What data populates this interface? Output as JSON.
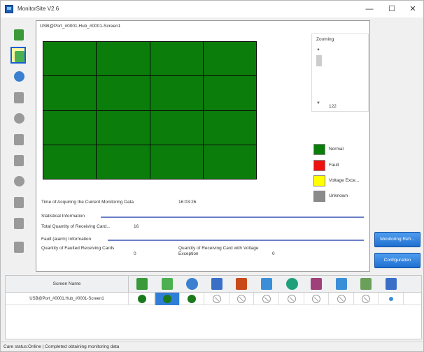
{
  "window": {
    "title": "MonitorSite V2.6",
    "minimize": "—",
    "maximize": "☐",
    "close": "✕"
  },
  "toolbar": {
    "items": [
      {
        "icon": "led-screen-icon",
        "color": "#3a9a3a"
      },
      {
        "icon": "receiving-card-icon",
        "color": "#4caf50",
        "selected": true
      },
      {
        "icon": "temperature-icon",
        "color": "#3a7fd0"
      },
      {
        "icon": "humidity-icon",
        "color": "#9a9a9a"
      },
      {
        "icon": "smoke-icon",
        "color": "#9a9a9a"
      },
      {
        "icon": "fan-icon",
        "color": "#9a9a9a"
      },
      {
        "icon": "module-icon",
        "color": "#9a9a9a"
      },
      {
        "icon": "voltage-icon",
        "color": "#9a9a9a"
      },
      {
        "icon": "magnet-icon",
        "color": "#9a9a9a"
      },
      {
        "icon": "door-icon",
        "color": "#9a9a9a"
      },
      {
        "icon": "cabinet-icon",
        "color": "#9a9a9a"
      }
    ]
  },
  "main": {
    "screen_title": "USB@Port_#0001.Hub_#0001-Screen1",
    "zoom": {
      "label": "Zooming",
      "value": "122",
      "up": "▲",
      "down": "▼"
    },
    "legend": [
      {
        "label": "Normal",
        "color": "#0b7d0b"
      },
      {
        "label": "Fault",
        "color": "#ee1111"
      },
      {
        "label": "Voltage Exce...",
        "color": "#ffff00"
      },
      {
        "label": "Unknown",
        "color": "#8a8a8a"
      }
    ],
    "acquire_label": "Time of Acquiring the Current Monitoring Data",
    "acquire_time": "16:03:26",
    "statistical_heading": "Statistical Information",
    "total_label": "Total Quantity of Receiving Card...",
    "total_value": "16",
    "fault_heading": "Fault (alarm) Information",
    "faulted_label": "Quantity of Faulted Receiving Cards",
    "faulted_value": "0",
    "voltage_label": "Quantity of Receiving Card with Voltage Exception",
    "voltage_value": "0"
  },
  "buttons": {
    "monitoring": "Monitoring Refr...",
    "configuration": "Configuration"
  },
  "table": {
    "header_name": "Screen Name",
    "row_name": "USB@Port_#0001.Hub_#0001-Screen1",
    "columns": [
      {
        "icon": "led-screen-icon",
        "color": "#3a9a3a",
        "status": "ok"
      },
      {
        "icon": "receiving-card-icon",
        "color": "#4caf50",
        "status": "ok",
        "selected": true
      },
      {
        "icon": "temperature-icon",
        "color": "#3a7fd0",
        "status": "ok"
      },
      {
        "icon": "humidity-icon",
        "color": "#3a6fc8",
        "status": "none"
      },
      {
        "icon": "smoke-icon",
        "color": "#c84a1a",
        "status": "none"
      },
      {
        "icon": "fan-icon",
        "color": "#3a8fd8",
        "status": "none"
      },
      {
        "icon": "voltage-icon",
        "color": "#1fa07a",
        "status": "none"
      },
      {
        "icon": "magnet-icon",
        "color": "#a0407a",
        "status": "none"
      },
      {
        "icon": "door-icon",
        "color": "#3a8fd8",
        "status": "none"
      },
      {
        "icon": "cabinet-icon",
        "color": "#6aa05a",
        "status": "none"
      },
      {
        "icon": "network-icon",
        "color": "#3a6fc8",
        "status": "small"
      }
    ]
  },
  "status": {
    "text": "Care status:Online  |  Completed obtaining monitoring data"
  }
}
